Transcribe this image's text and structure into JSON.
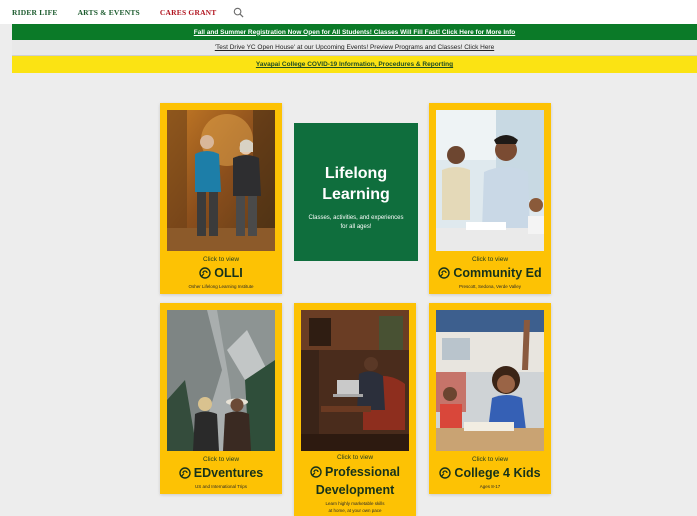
{
  "nav": {
    "items": [
      "RIDER LIFE",
      "ARTS & EVENTS",
      "CARES GRANT"
    ],
    "search_icon": "search-icon"
  },
  "banners": {
    "registration": "Fall and Summer Registration Now Open for All Students! Classes Will Fill Fast! Click Here for More Info",
    "open_house": "'Test Drive YC Open House' at our Upcoming Events! Preview Programs and Classes! Click Here",
    "covid": "Yavapai College COVID-19 Information, Procedures & Reporting"
  },
  "feature": {
    "title_line1": "Lifelong",
    "title_line2": "Learning",
    "description": "Classes, activities, and experiences for all ages!"
  },
  "cards": {
    "olli": {
      "click": "Click to view",
      "title": "OLLI",
      "subtitle": "Osher Lifelong Learning Institute"
    },
    "community": {
      "click": "Click to view",
      "title": "Community Ed",
      "subtitle": "Prescott, Sedona, Verde Valley"
    },
    "edventures": {
      "click": "Click to view",
      "title": "EDventures",
      "subtitle": "US and International Trips"
    },
    "professional": {
      "click": "Click to view",
      "title_line1": "Professional",
      "title_line2": "Development",
      "subtitle_line1": "Learn highly marketable skills",
      "subtitle_line2": "at home, at your own pace"
    },
    "kids": {
      "click": "Click to view",
      "title": "College 4 Kids",
      "subtitle": "Ages 8-17"
    }
  },
  "colors": {
    "card_yellow": "#fdc204",
    "feature_green": "#0f6e3d",
    "banner_green": "#0b7a28",
    "banner_yellow": "#fbe313",
    "nav_green": "#1c5b2e",
    "nav_red": "#b1141f"
  }
}
